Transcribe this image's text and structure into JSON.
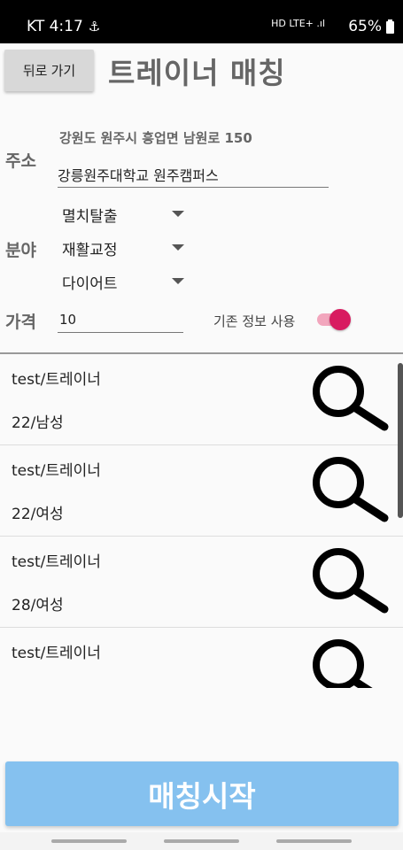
{
  "status_bar": {
    "carrier_time": "KT 4:17",
    "notification_icon": "anchor-icon",
    "network": "HD LTE+ .ıl",
    "battery": "65%"
  },
  "header": {
    "back_label": "뒤로 가기",
    "title": "트레이너 매칭"
  },
  "address": {
    "label": "주소",
    "text": "강원도 원주시 흥업면 남원로 150",
    "input_value": "강릉원주대학교 원주캠퍼스"
  },
  "field": {
    "label": "분야",
    "selects": [
      "멸치탈출",
      "재활교정",
      "다이어트"
    ]
  },
  "price": {
    "label": "가격",
    "value": "10",
    "switch_label": "기존 정보 사용",
    "switch_on": true
  },
  "trainers": [
    {
      "name": "test/트레이너",
      "info": "22/남성"
    },
    {
      "name": "test/트레이너",
      "info": "22/여성"
    },
    {
      "name": "test/트레이너",
      "info": "28/여성"
    },
    {
      "name": "test/트레이너",
      "info": ""
    }
  ],
  "start_button": "매칭시작",
  "colors": {
    "accent": "#d81b60",
    "start_button": "#85c1ef"
  }
}
